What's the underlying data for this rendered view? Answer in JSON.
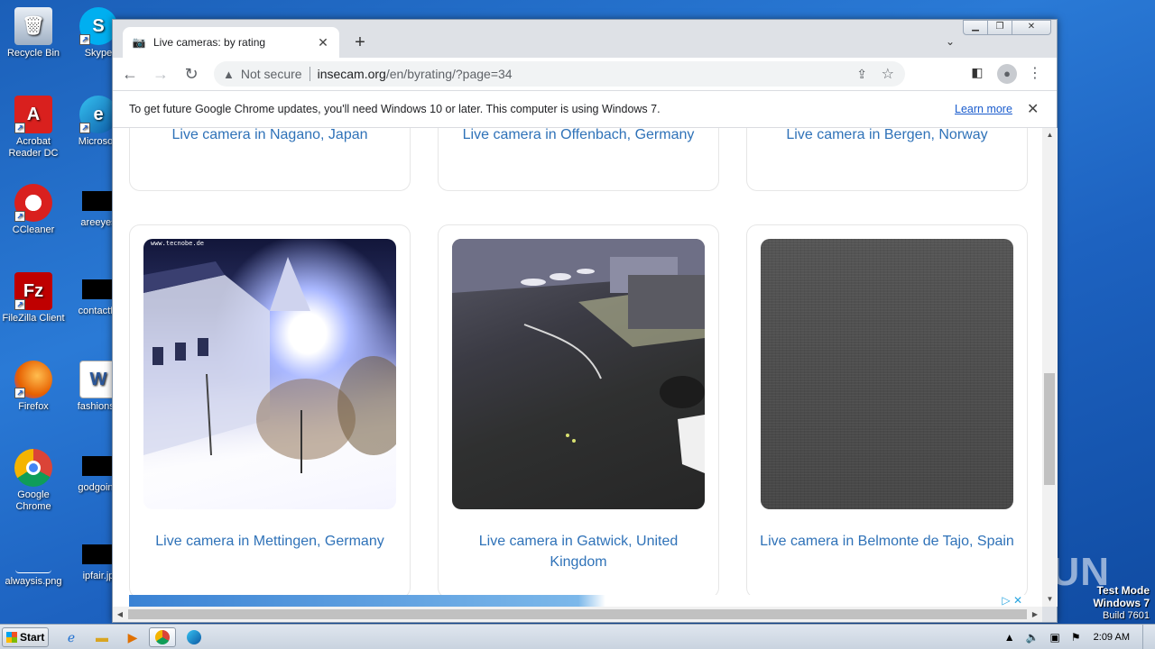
{
  "desktop": {
    "icons": [
      {
        "label": "Recycle Bin"
      },
      {
        "label": "Skype"
      },
      {
        "label": "Acrobat Reader DC"
      },
      {
        "label": "Microsoft"
      },
      {
        "label": "CCleaner"
      },
      {
        "label": "areeyes"
      },
      {
        "label": "FileZilla Client"
      },
      {
        "label": "contactfri"
      },
      {
        "label": "Firefox"
      },
      {
        "label": "fashionsy"
      },
      {
        "label": "Google Chrome"
      },
      {
        "label": "godgoing"
      },
      {
        "label": "alwaysis.png"
      },
      {
        "label": "ipfair.jp"
      }
    ],
    "watermark": "ANY RUN",
    "test_mode": {
      "line1": "Test Mode",
      "line2": "Windows 7",
      "line3": "Build 7601"
    }
  },
  "browser": {
    "tab": {
      "title": "Live cameras: by rating",
      "icon": "camera-favicon"
    },
    "address": {
      "security_label": "Not secure",
      "host": "insecam.org",
      "path": "/en/byrating/?page=34"
    },
    "infobar": {
      "message": "To get future Google Chrome updates, you'll need Windows 10 or later. This computer is using Windows 7.",
      "link": "Learn more"
    }
  },
  "page": {
    "top_row": [
      {
        "caption": "Live camera in Nagano, Japan"
      },
      {
        "caption": "Live camera in Offenbach, Germany"
      },
      {
        "caption": "Live camera in Bergen, Norway"
      }
    ],
    "cards": [
      {
        "caption": "Live camera in Mettingen, Germany",
        "overlay": "www.tecnobe.de"
      },
      {
        "caption": "Live camera in Gatwick, United Kingdom"
      },
      {
        "caption": "Live camera in Belmonte de Tajo, Spain"
      }
    ]
  },
  "taskbar": {
    "start_label": "Start",
    "clock": "2:09 AM"
  },
  "colors": {
    "link": "#2f72b8",
    "desktop_bg": "#1b5fb8",
    "chrome_frame": "#dee1e6"
  }
}
